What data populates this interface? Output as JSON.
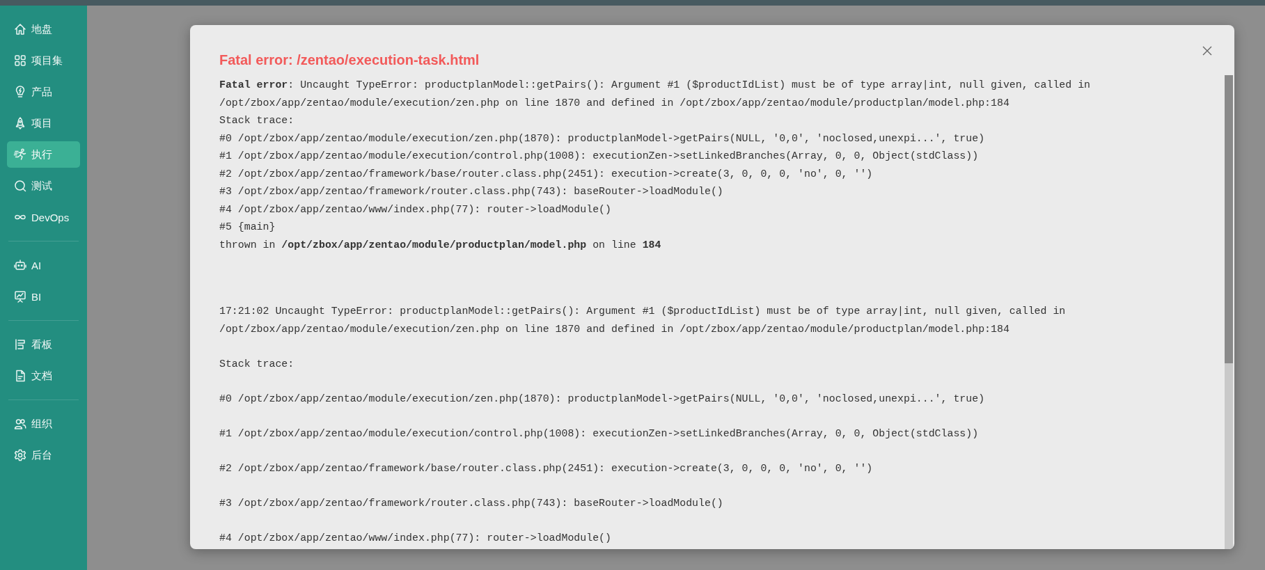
{
  "sidebar": {
    "groups": [
      {
        "items": [
          {
            "label": "地盘",
            "selected": false
          },
          {
            "label": "项目集",
            "selected": false
          },
          {
            "label": "产品",
            "selected": false
          },
          {
            "label": "项目",
            "selected": false
          },
          {
            "label": "执行",
            "selected": true
          },
          {
            "label": "测试",
            "selected": false
          },
          {
            "label": "DevOps",
            "selected": false
          }
        ]
      },
      {
        "items": [
          {
            "label": "AI",
            "selected": false
          },
          {
            "label": "BI",
            "selected": false
          }
        ]
      },
      {
        "items": [
          {
            "label": "看板",
            "selected": false
          },
          {
            "label": "文档",
            "selected": false
          }
        ]
      },
      {
        "items": [
          {
            "label": "组织",
            "selected": false
          },
          {
            "label": "后台",
            "selected": false
          }
        ]
      }
    ]
  },
  "dialog": {
    "title": "Fatal error: /zentao/execution-task.html",
    "blocks": [
      {
        "paragraphs": [
          [
            "**Fatal error**: Uncaught TypeError: productplanModel::getPairs(): Argument #1 ($productIdList) must be of type array|int, null given, called in",
            "/opt/zbox/app/zentao/module/execution/zen.php on line 1870 and defined in /opt/zbox/app/zentao/module/productplan/model.php:184",
            "Stack trace:",
            "#0 /opt/zbox/app/zentao/module/execution/zen.php(1870): productplanModel->getPairs(NULL, '0,0', 'noclosed,unexpi...', true)",
            "#1 /opt/zbox/app/zentao/module/execution/control.php(1008): executionZen->setLinkedBranches(Array, 0, 0, Object(stdClass))",
            "#2 /opt/zbox/app/zentao/framework/base/router.class.php(2451): execution->create(3, 0, 0, 0, 'no', 0, '')",
            "#3 /opt/zbox/app/zentao/framework/router.class.php(743): baseRouter->loadModule()",
            "#4 /opt/zbox/app/zentao/www/index.php(77): router->loadModule()",
            "#5 {main}",
            "thrown in **/opt/zbox/app/zentao/module/productplan/model.php** on line **184**"
          ]
        ]
      },
      {
        "paragraphs": [
          [
            "17:21:02 Uncaught TypeError: productplanModel::getPairs(): Argument #1 ($productIdList) must be of type array|int, null given, called in",
            "/opt/zbox/app/zentao/module/execution/zen.php on line 1870 and defined in /opt/zbox/app/zentao/module/productplan/model.php:184"
          ],
          [
            "Stack trace:"
          ],
          [
            "#0 /opt/zbox/app/zentao/module/execution/zen.php(1870): productplanModel->getPairs(NULL, '0,0', 'noclosed,unexpi...', true)"
          ],
          [
            "#1 /opt/zbox/app/zentao/module/execution/control.php(1008): executionZen->setLinkedBranches(Array, 0, 0, Object(stdClass))"
          ],
          [
            "#2 /opt/zbox/app/zentao/framework/base/router.class.php(2451): execution->create(3, 0, 0, 0, 'no', 0, '')"
          ],
          [
            "#3 /opt/zbox/app/zentao/framework/router.class.php(743): baseRouter->loadModule()"
          ],
          [
            "#4 /opt/zbox/app/zentao/www/index.php(77): router->loadModule()"
          ]
        ]
      }
    ]
  }
}
